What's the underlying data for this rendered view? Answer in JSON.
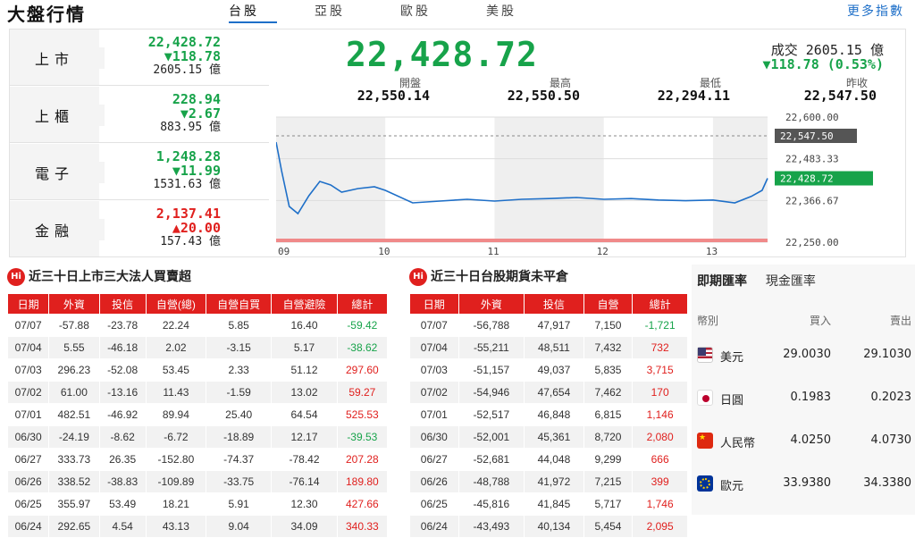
{
  "header": {
    "brand": "大盤行情",
    "tabs": [
      "台股",
      "亞股",
      "歐股",
      "美股"
    ],
    "more": "更多指數"
  },
  "indices": [
    {
      "name": "上市",
      "value": "22,428.72",
      "change": "▼118.78",
      "dir": "down",
      "volume": "2605.15 億"
    },
    {
      "name": "上櫃",
      "value": "228.94",
      "change": "▼2.67",
      "dir": "down",
      "volume": "883.95 億"
    },
    {
      "name": "電子",
      "value": "1,248.28",
      "change": "▼11.99",
      "dir": "down",
      "volume": "1531.63 億"
    },
    {
      "name": "金融",
      "value": "2,137.41",
      "change": "▲20.00",
      "dir": "up",
      "volume": "157.43 億"
    }
  ],
  "main": {
    "price": "22,428.72",
    "volume_line": "成交 2605.15 億",
    "change_line": "▼118.78 (0.53%)",
    "ohlc": [
      {
        "label": "開盤",
        "value": "22,550.14"
      },
      {
        "label": "最高",
        "value": "22,550.50"
      },
      {
        "label": "最低",
        "value": "22,294.11"
      },
      {
        "label": "昨收",
        "value": "22,547.50"
      }
    ]
  },
  "chart_data": {
    "type": "line",
    "x_tick_labels": [
      "09",
      "10",
      "11",
      "12",
      "13"
    ],
    "y_tick_labels": [
      "22,600.00",
      "22,483.33",
      "22,366.67",
      "22,250.00"
    ],
    "ylim": [
      22250,
      22600
    ],
    "prev_close_label": "22,547.50",
    "prev_close": 22547.5,
    "last_label": "22,428.72",
    "last": 22428.72,
    "x_hours": [
      9.0,
      9.05,
      9.12,
      9.2,
      9.3,
      9.4,
      9.5,
      9.6,
      9.75,
      9.9,
      10.0,
      10.25,
      10.5,
      10.75,
      11.0,
      11.25,
      11.5,
      11.75,
      12.0,
      12.25,
      12.5,
      12.75,
      13.0,
      13.2,
      13.35,
      13.45,
      13.5
    ],
    "y": [
      22530,
      22450,
      22350,
      22330,
      22380,
      22420,
      22410,
      22390,
      22400,
      22405,
      22395,
      22360,
      22365,
      22370,
      22365,
      22370,
      22372,
      22375,
      22370,
      22372,
      22368,
      22366,
      22368,
      22360,
      22378,
      22395,
      22428.72
    ],
    "line_color": "#1e6fc8",
    "grid": true
  },
  "inst_table": {
    "title": "近三十日上市三大法人買賣超",
    "headers": [
      "日期",
      "外資",
      "投信",
      "自營(總)",
      "自營自買",
      "自營避險",
      "總計"
    ],
    "rows": [
      [
        "07/07",
        "-57.88",
        "-23.78",
        "22.24",
        "5.85",
        "16.40",
        "-59.42"
      ],
      [
        "07/04",
        "5.55",
        "-46.18",
        "2.02",
        "-3.15",
        "5.17",
        "-38.62"
      ],
      [
        "07/03",
        "296.23",
        "-52.08",
        "53.45",
        "2.33",
        "51.12",
        "297.60"
      ],
      [
        "07/02",
        "61.00",
        "-13.16",
        "11.43",
        "-1.59",
        "13.02",
        "59.27"
      ],
      [
        "07/01",
        "482.51",
        "-46.92",
        "89.94",
        "25.40",
        "64.54",
        "525.53"
      ],
      [
        "06/30",
        "-24.19",
        "-8.62",
        "-6.72",
        "-18.89",
        "12.17",
        "-39.53"
      ],
      [
        "06/27",
        "333.73",
        "26.35",
        "-152.80",
        "-74.37",
        "-78.42",
        "207.28"
      ],
      [
        "06/26",
        "338.52",
        "-38.83",
        "-109.89",
        "-33.75",
        "-76.14",
        "189.80"
      ],
      [
        "06/25",
        "355.97",
        "53.49",
        "18.21",
        "5.91",
        "12.30",
        "427.66"
      ],
      [
        "06/24",
        "292.65",
        "4.54",
        "43.13",
        "9.04",
        "34.09",
        "340.33"
      ]
    ]
  },
  "fut_table": {
    "title": "近三十日台股期貨未平倉",
    "headers": [
      "日期",
      "外資",
      "投信",
      "自營",
      "總計"
    ],
    "rows": [
      [
        "07/07",
        "-56,788",
        "47,917",
        "7,150",
        "-1,721"
      ],
      [
        "07/04",
        "-55,211",
        "48,511",
        "7,432",
        "732"
      ],
      [
        "07/03",
        "-51,157",
        "49,037",
        "5,835",
        "3,715"
      ],
      [
        "07/02",
        "-54,946",
        "47,654",
        "7,462",
        "170"
      ],
      [
        "07/01",
        "-52,517",
        "46,848",
        "6,815",
        "1,146"
      ],
      [
        "06/30",
        "-52,001",
        "45,361",
        "8,720",
        "2,080"
      ],
      [
        "06/27",
        "-52,681",
        "44,048",
        "9,299",
        "666"
      ],
      [
        "06/26",
        "-48,788",
        "41,972",
        "7,215",
        "399"
      ],
      [
        "06/25",
        "-45,816",
        "41,845",
        "5,717",
        "1,746"
      ],
      [
        "06/24",
        "-43,493",
        "40,134",
        "5,454",
        "2,095"
      ]
    ]
  },
  "fx": {
    "tabs": [
      "即期匯率",
      "現金匯率"
    ],
    "headers": {
      "currency": "幣別",
      "buy": "買入",
      "sell": "賣出"
    },
    "rows": [
      {
        "name": "美元",
        "buy": "29.0030",
        "sell": "29.1030",
        "flag": "us-flag-icon"
      },
      {
        "name": "日圓",
        "buy": "0.1983",
        "sell": "0.2023",
        "flag": "jp-flag-icon"
      },
      {
        "name": "人民幣",
        "buy": "4.0250",
        "sell": "4.0730",
        "flag": "cn-flag-icon"
      },
      {
        "name": "歐元",
        "buy": "33.9380",
        "sell": "34.3380",
        "flag": "eu-flag-icon"
      }
    ]
  },
  "colors": {
    "up": "#e0201e",
    "down": "#17a34a",
    "accent": "#1e6fc8",
    "header_red": "#e0201e"
  }
}
